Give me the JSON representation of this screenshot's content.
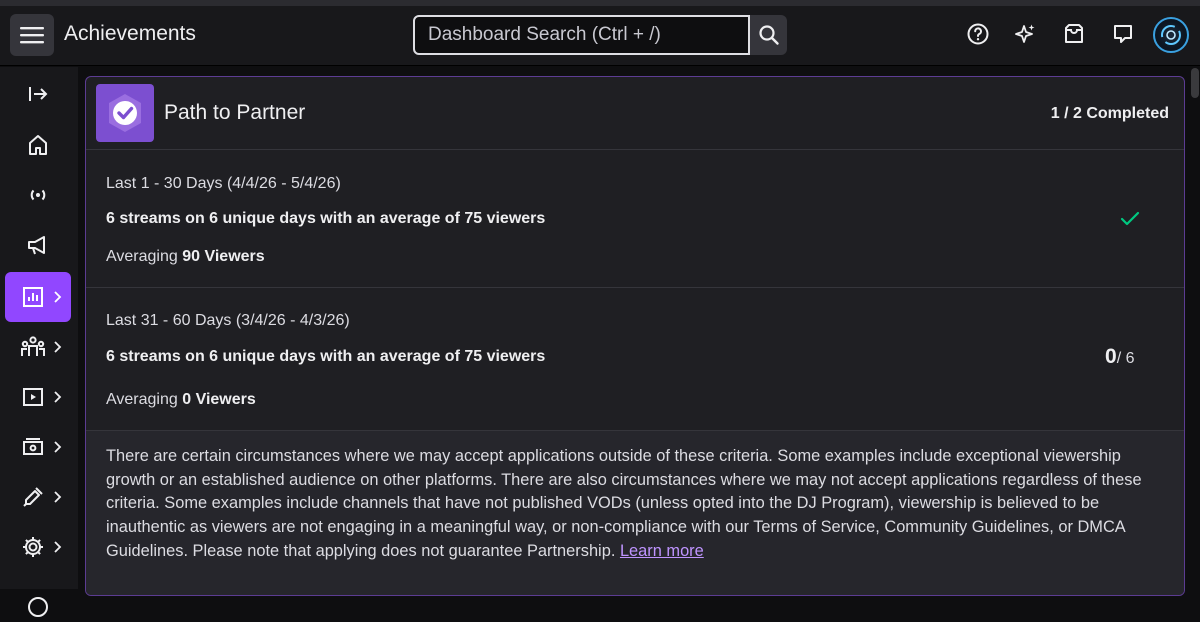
{
  "header": {
    "app_title": "Achievements",
    "search_placeholder": "Dashboard Search (Ctrl + /)",
    "icons": [
      "menu-icon",
      "search-icon",
      "help-icon",
      "sparkle-icon",
      "inbox-icon",
      "whispers-icon",
      "avatar"
    ]
  },
  "sidebar": {
    "items": [
      {
        "icon": "collapse-arrow-icon",
        "active": false
      },
      {
        "icon": "home-icon",
        "active": false
      },
      {
        "icon": "broadcast-icon",
        "active": false
      },
      {
        "icon": "megaphone-icon",
        "active": false
      },
      {
        "icon": "analytics-icon",
        "active": true
      },
      {
        "icon": "community-icon",
        "active": false
      },
      {
        "icon": "content-icon",
        "active": false
      },
      {
        "icon": "monetization-icon",
        "active": false
      },
      {
        "icon": "extensions-icon",
        "active": false
      },
      {
        "icon": "settings-icon",
        "active": false
      }
    ]
  },
  "card": {
    "title": "Path to Partner",
    "completed": "1 / 2 Completed",
    "sections": [
      {
        "range": "Last 1 - 30 Days (4/4/26 - 5/4/26)",
        "criteria": "6 streams on 6 unique days with an average of 75 viewers",
        "averaging_label": "Averaging",
        "averaging_value": "90 Viewers",
        "status": "complete"
      },
      {
        "range": "Last 31 - 60 Days (3/4/26 - 4/3/26)",
        "criteria": "6 streams on 6 unique days with an average of 75 viewers",
        "averaging_label": "Averaging",
        "averaging_value": "0 Viewers",
        "progress_current": "0",
        "progress_total": "/ 6"
      }
    ],
    "footer_text": "There are certain circumstances where we may accept applications outside of these criteria. Some examples include exceptional viewership growth or an established audience on other platforms. There are also circumstances where we may not accept applications regardless of these criteria. Some examples include channels that have not published VODs (unless opted into the DJ Program), viewership is believed to be inauthentic as viewers are not engaging in a meaningful way, or non-compliance with our Terms of Service, Community Guidelines, or DMCA Guidelines. Please note that applying does not guarantee Partnership.",
    "footer_link": "Learn more"
  },
  "colors": {
    "accent": "#9147ff",
    "success": "#00c880",
    "link": "#bf94ff"
  }
}
